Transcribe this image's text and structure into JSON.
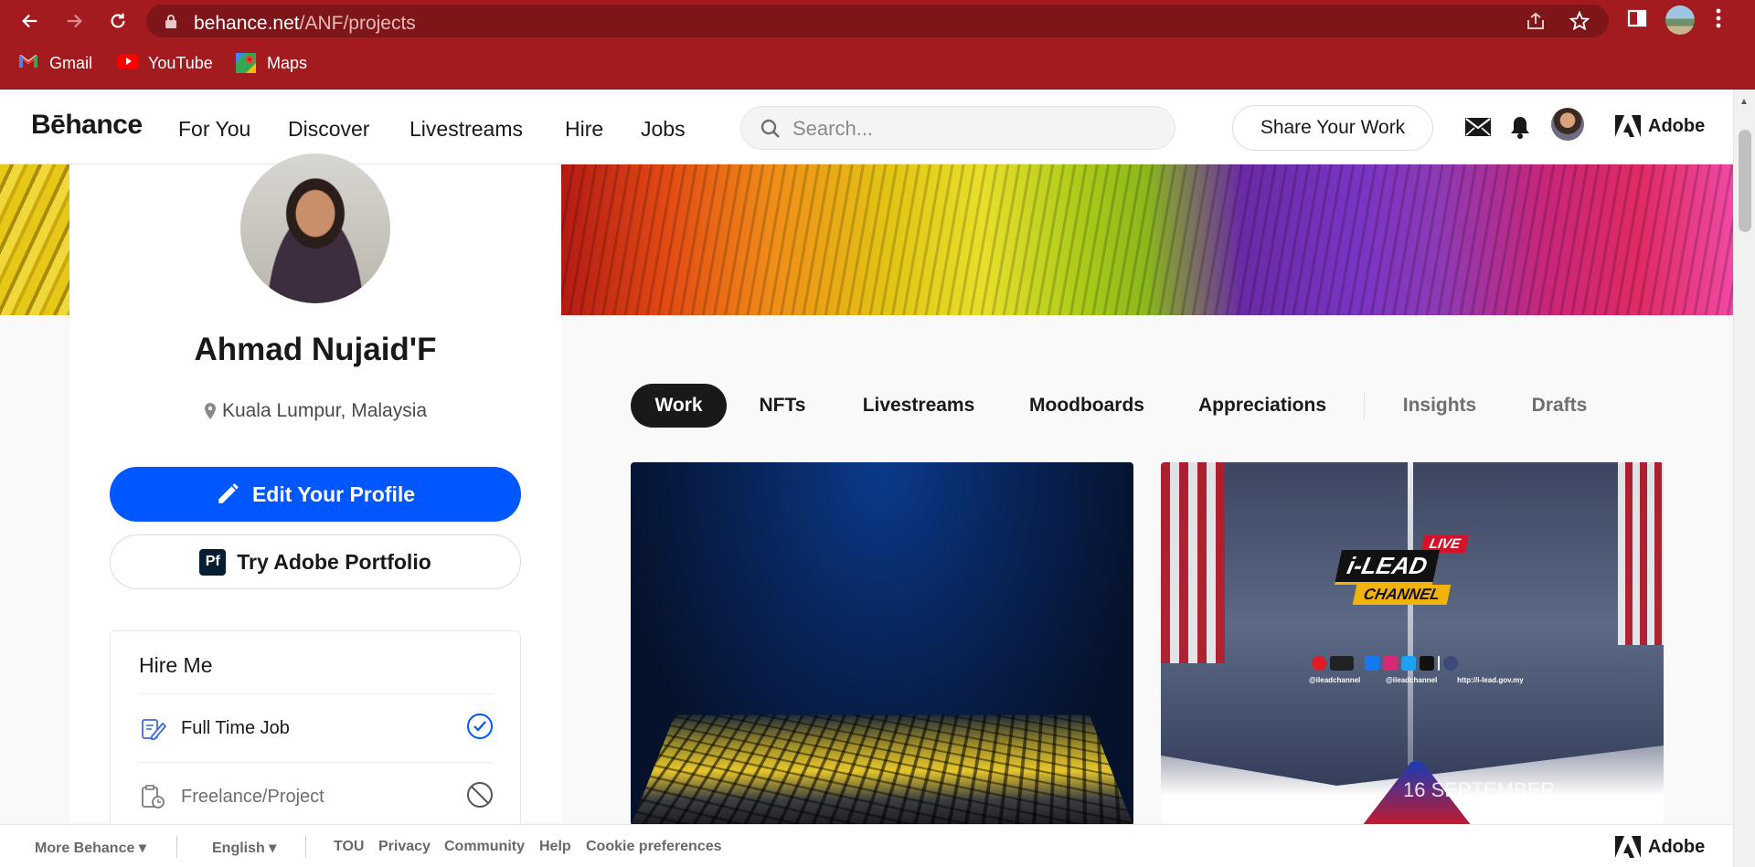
{
  "browser": {
    "url_domain": "behance.net",
    "url_path": "/ANF/projects",
    "bookmarks": [
      {
        "label": "Gmail",
        "icon": "gmail-icon"
      },
      {
        "label": "YouTube",
        "icon": "youtube-icon"
      },
      {
        "label": "Maps",
        "icon": "maps-icon"
      }
    ]
  },
  "header": {
    "logo": "Bēhance",
    "nav": [
      "For You",
      "Discover",
      "Livestreams",
      "Hire",
      "Jobs"
    ],
    "search_placeholder": "Search...",
    "share_label": "Share Your Work",
    "adobe_label": "Adobe"
  },
  "profile": {
    "name": "Ahmad Nujaid'F",
    "location": "Kuala Lumpur, Malaysia",
    "edit_label": "Edit Your Profile",
    "portfolio_label": "Try Adobe Portfolio",
    "portfolio_badge": "Pf",
    "hire": {
      "title": "Hire Me",
      "options": [
        {
          "label": "Full Time Job",
          "state": "available"
        },
        {
          "label": "Freelance/Project",
          "state": "unavailable"
        }
      ]
    }
  },
  "tabs": {
    "items": [
      "Work",
      "NFTs",
      "Livestreams",
      "Moodboards",
      "Appreciations"
    ],
    "private": [
      "Insights",
      "Drafts"
    ],
    "active": "Work"
  },
  "projects": {
    "card2": {
      "live": "LIVE",
      "brand": "i-LEAD",
      "channel": "CHANNEL",
      "handle_1": "@ileadchannel",
      "handle_2": "@ileadchannel",
      "site": "http://i-lead.gov.my",
      "date": "16 SEPTEMBER"
    }
  },
  "footer": {
    "more": "More Behance",
    "language": "English",
    "links": [
      "TOU",
      "Privacy",
      "Community",
      "Help",
      "Cookie preferences"
    ],
    "adobe_label": "Adobe"
  },
  "colors": {
    "chrome": "#a31b1f",
    "primary_button": "#0057ff",
    "active_tab": "#191919"
  }
}
